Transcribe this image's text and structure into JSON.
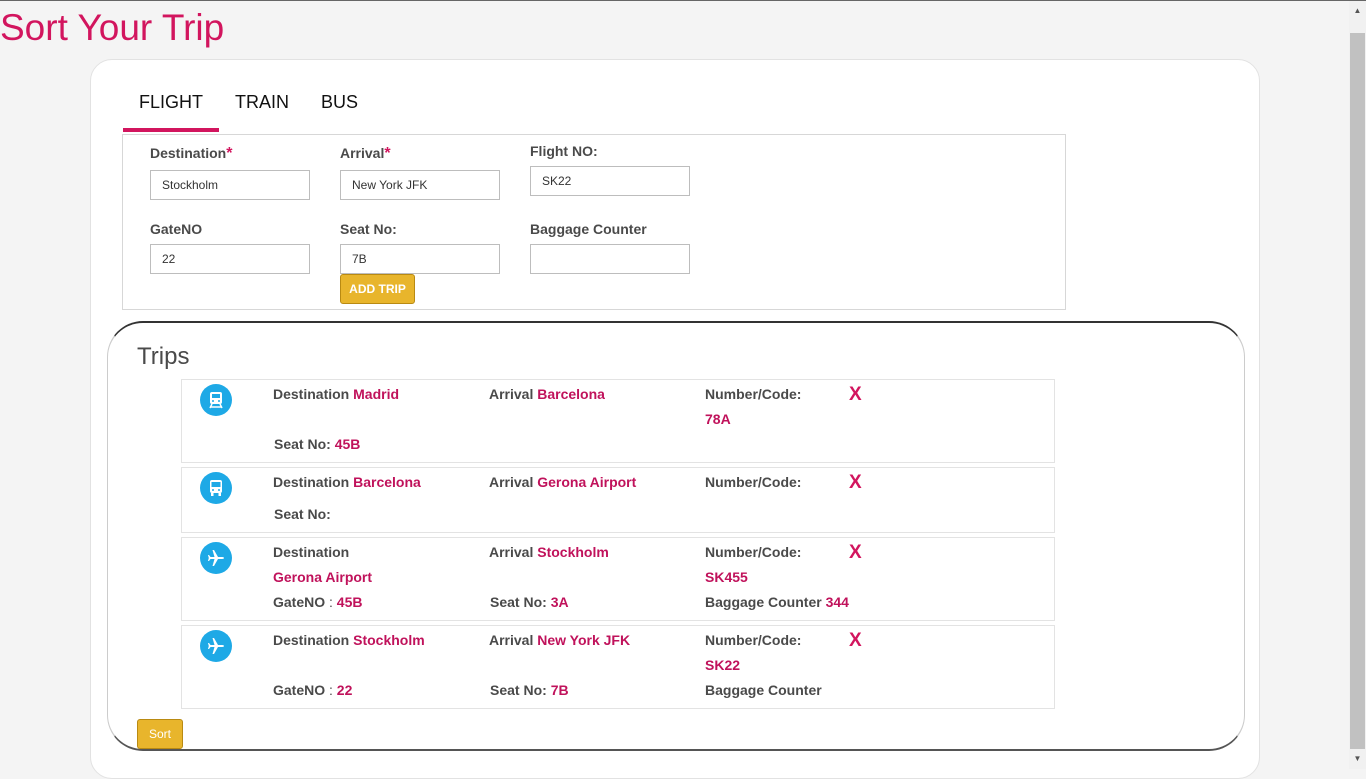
{
  "page": {
    "title": "Sort Your Trip"
  },
  "tabs": [
    {
      "label": "FLIGHT",
      "active": true
    },
    {
      "label": "TRAIN",
      "active": false
    },
    {
      "label": "BUS",
      "active": false
    }
  ],
  "form": {
    "destination": {
      "label": "Destination",
      "required_mark": "*",
      "value": "Stockholm"
    },
    "arrival": {
      "label": "Arrival",
      "required_mark": "*",
      "value": "New York JFK"
    },
    "flight_no": {
      "label": "Flight NO:",
      "value": "SK22"
    },
    "gate_no": {
      "label": "GateNO",
      "value": "22"
    },
    "seat_no": {
      "label": "Seat No:",
      "value": "7B"
    },
    "baggage_counter": {
      "label": "Baggage Counter",
      "value": ""
    },
    "add_trip_label": "ADD TRIP"
  },
  "trips_section": {
    "title": "Trips",
    "delete_label": "X",
    "labels": {
      "destination": "Destination",
      "arrival": "Arrival",
      "number_code": "Number/Code:",
      "seat_no": "Seat No:",
      "gate_no": "GateNO",
      "gate_sep": ":",
      "baggage_counter": "Baggage Counter"
    },
    "trips": [
      {
        "icon": "train-icon",
        "destination": "Madrid",
        "arrival": "Barcelona",
        "number": "78A",
        "seat": "45B"
      },
      {
        "icon": "bus-icon",
        "destination": "Barcelona",
        "arrival": "Gerona Airport",
        "number": "",
        "seat": ""
      },
      {
        "icon": "airplane-icon",
        "destination": "Gerona Airport",
        "arrival": "Stockholm",
        "number": "SK455",
        "gate": "45B",
        "seat": "3A",
        "baggage": "344"
      },
      {
        "icon": "airplane-icon",
        "destination": "Stockholm",
        "arrival": "New York JFK",
        "number": "SK22",
        "gate": "22",
        "seat": "7B",
        "baggage": ""
      }
    ]
  },
  "sort_label": "Sort",
  "colors": {
    "accent": "#d2155e",
    "button": "#e8b52c",
    "icon_bg": "#1ea9e6"
  }
}
